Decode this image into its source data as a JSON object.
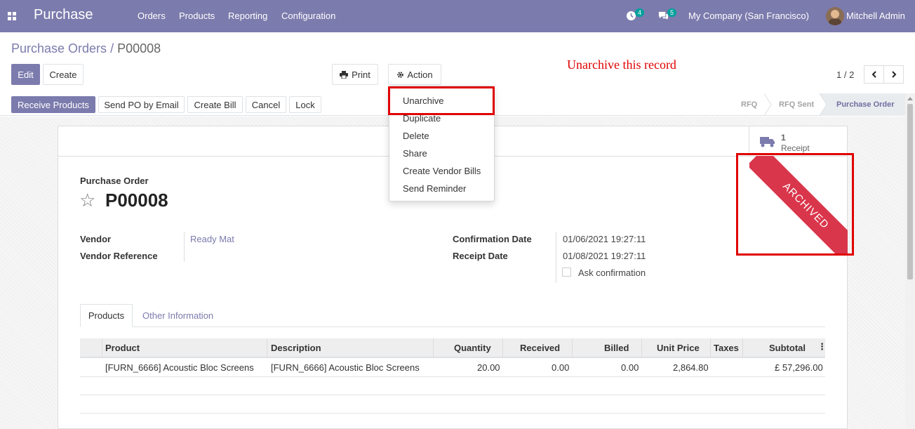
{
  "navbar": {
    "app_name": "Purchase",
    "menu": [
      "Orders",
      "Products",
      "Reporting",
      "Configuration"
    ],
    "activity_count": "4",
    "message_count": "5",
    "company": "My Company (San Francisco)",
    "user": "Mitchell Admin",
    "color": "#7c7bad"
  },
  "breadcrumb": {
    "parent": "Purchase Orders",
    "separator": "/",
    "current": "P00008"
  },
  "control": {
    "edit": "Edit",
    "create": "Create",
    "print": "Print",
    "action": "Action",
    "pager": "1 / 2"
  },
  "annotation": "Unarchive this record",
  "action_menu": [
    "Unarchive",
    "Duplicate",
    "Delete",
    "Share",
    "Create Vendor Bills",
    "Send Reminder"
  ],
  "statusbar": {
    "buttons": [
      "Receive Products",
      "Send PO by Email",
      "Create Bill",
      "Cancel",
      "Lock"
    ],
    "stages": [
      "RFQ",
      "RFQ Sent",
      "Purchase Order"
    ],
    "active_stage": "Purchase Order"
  },
  "smart_button": {
    "count": "1",
    "label": "Receipt"
  },
  "ribbon": "ARCHIVED",
  "form": {
    "type_label": "Purchase Order",
    "name": "P00008",
    "vendor_label": "Vendor",
    "vendor_value": "Ready Mat",
    "vendor_ref_label": "Vendor Reference",
    "confirmation_label": "Confirmation Date",
    "confirmation_value": "01/06/2021 19:27:11",
    "receipt_label": "Receipt Date",
    "receipt_value": "01/08/2021 19:27:11",
    "ask_confirmation": "Ask confirmation"
  },
  "tabs": [
    "Products",
    "Other Information"
  ],
  "table": {
    "headers": [
      "Product",
      "Description",
      "Quantity",
      "Received",
      "Billed",
      "Unit Price",
      "Taxes",
      "Subtotal"
    ],
    "rows": [
      [
        "[FURN_6666] Acoustic Bloc Screens",
        "[FURN_6666] Acoustic Bloc Screens",
        "20.00",
        "0.00",
        "0.00",
        "2,864.80",
        "",
        "£ 57,296.00"
      ]
    ]
  }
}
